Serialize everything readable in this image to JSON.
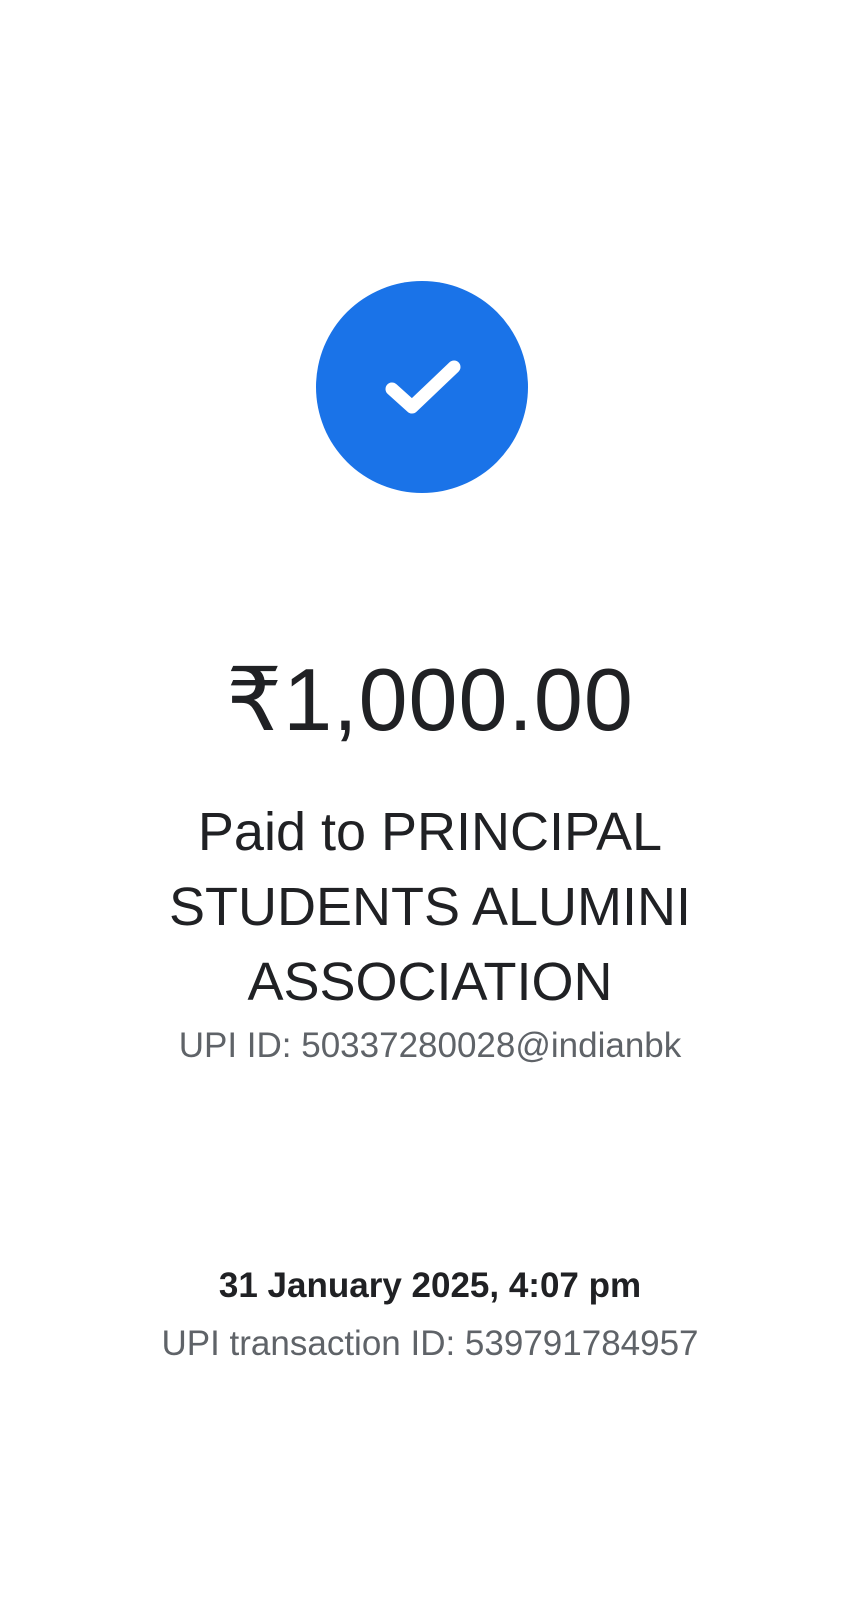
{
  "status": {
    "icon": "check-icon",
    "accent_color": "#1a73e8"
  },
  "payment": {
    "amount": "₹1,000.00",
    "payee_line": "Paid to PRINCIPAL STUDENTS ALUMINI ASSOCIATION",
    "upi_id": "UPI ID: 50337280028@indianbk"
  },
  "transaction": {
    "datetime": "31 January 2025, 4:07 pm",
    "upi_transaction_id": "UPI transaction ID: 539791784957"
  }
}
